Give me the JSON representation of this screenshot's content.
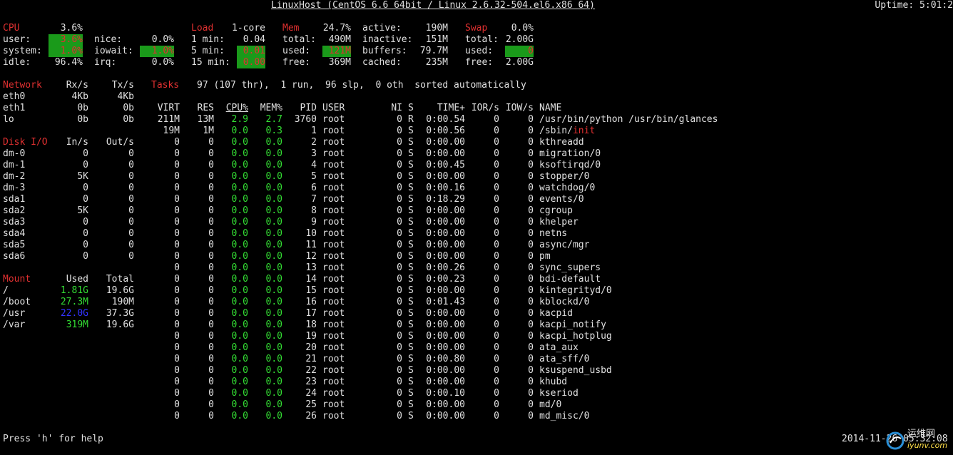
{
  "header": {
    "title": "LinuxHost (CentOS 6.6 64bit / Linux 2.6.32-504.el6.x86 64)",
    "uptime": "Uptime: 5:01:2"
  },
  "cpu": {
    "title": "CPU",
    "total": "3.6%",
    "user_label": "user:",
    "user": "3.6%",
    "system_label": "system:",
    "system": "1.0%",
    "idle_label": "idle:",
    "idle": "96.4%",
    "nice_label": "nice:",
    "nice": "0.0%",
    "iowait_label": "iowait:",
    "iowait": "1.0%",
    "irq_label": "irq:",
    "irq": "0.0%"
  },
  "load": {
    "title": "Load",
    "cores": "1-core",
    "min1_label": "1 min:",
    "min1": "0.04",
    "min5_label": "5 min:",
    "min5": "0.01",
    "min15_label": "15 min:",
    "min15": "0.00"
  },
  "mem": {
    "title": "Mem",
    "percent": "24.7%",
    "total_label": "total:",
    "total": "490M",
    "used_label": "used:",
    "used": "121M",
    "free_label": "free:",
    "free": "369M",
    "active_label": "active:",
    "active": "190M",
    "inactive_label": "inactive:",
    "inactive": "151M",
    "buffers_label": "buffers:",
    "buffers": "79.7M",
    "cached_label": "cached:",
    "cached": "235M"
  },
  "swap": {
    "title": "Swap",
    "percent": "0.0%",
    "total_label": "total:",
    "total": "2.00G",
    "used_label": "used:",
    "used": "0",
    "free_label": "free:",
    "free": "2.00G"
  },
  "network": {
    "title": "Network",
    "rx_header": "Rx/s",
    "tx_header": "Tx/s",
    "rows": [
      {
        "name": "eth0",
        "rx": "4Kb",
        "tx": "4Kb"
      },
      {
        "name": "eth1",
        "rx": "0b",
        "tx": "0b"
      },
      {
        "name": "lo",
        "rx": "0b",
        "tx": "0b"
      }
    ]
  },
  "disk": {
    "title": "Disk I/O",
    "in_header": "In/s",
    "out_header": "Out/s",
    "rows": [
      {
        "name": "dm-0",
        "in": "0",
        "out": "0"
      },
      {
        "name": "dm-1",
        "in": "0",
        "out": "0"
      },
      {
        "name": "dm-2",
        "in": "5K",
        "out": "0"
      },
      {
        "name": "dm-3",
        "in": "0",
        "out": "0"
      },
      {
        "name": "sda1",
        "in": "0",
        "out": "0"
      },
      {
        "name": "sda2",
        "in": "5K",
        "out": "0"
      },
      {
        "name": "sda3",
        "in": "0",
        "out": "0"
      },
      {
        "name": "sda4",
        "in": "0",
        "out": "0"
      },
      {
        "name": "sda5",
        "in": "0",
        "out": "0"
      },
      {
        "name": "sda6",
        "in": "0",
        "out": "0"
      }
    ]
  },
  "mount": {
    "title": "Mount",
    "used_header": "Used",
    "total_header": "Total",
    "rows": [
      {
        "name": "/",
        "used": "1.81G",
        "total": "19.6G",
        "color": "green"
      },
      {
        "name": "/boot",
        "used": "27.3M",
        "total": "190M",
        "color": "green"
      },
      {
        "name": "/usr",
        "used": "22.0G",
        "total": "37.3G",
        "color": "blue"
      },
      {
        "name": "/var",
        "used": "319M",
        "total": "19.6G",
        "color": "green"
      }
    ]
  },
  "tasks": {
    "title": "Tasks",
    "summary": "97 (107 thr),  1 run,  96 slp,  0 oth  sorted automatically"
  },
  "process_table": {
    "headers": {
      "virt": "VIRT",
      "res": "RES",
      "cpu": "CPU%",
      "mem": "MEM%",
      "pid": "PID",
      "user": "USER",
      "ni": "NI",
      "s": "S",
      "time": "TIME+",
      "ior": "IOR/s",
      "iow": "IOW/s",
      "name": "NAME"
    },
    "rows": [
      {
        "virt": "211M",
        "res": "13M",
        "cpu": "2.9",
        "mem": "2.7",
        "pid": "3760",
        "user": "root",
        "ni": "0",
        "s": "R",
        "time": "0:00.54",
        "ior": "0",
        "iow": "0",
        "name": "/usr/bin/python /usr/bin/glances",
        "name2": ""
      },
      {
        "virt": "19M",
        "res": "1M",
        "cpu": "0.0",
        "mem": "0.3",
        "pid": "1",
        "user": "root",
        "ni": "0",
        "s": "S",
        "time": "0:00.56",
        "ior": "0",
        "iow": "0",
        "name": "/sbin/",
        "name2": "init"
      },
      {
        "virt": "0",
        "res": "0",
        "cpu": "0.0",
        "mem": "0.0",
        "pid": "2",
        "user": "root",
        "ni": "0",
        "s": "S",
        "time": "0:00.00",
        "ior": "0",
        "iow": "0",
        "name": "kthreadd",
        "name2": ""
      },
      {
        "virt": "0",
        "res": "0",
        "cpu": "0.0",
        "mem": "0.0",
        "pid": "3",
        "user": "root",
        "ni": "0",
        "s": "S",
        "time": "0:00.00",
        "ior": "0",
        "iow": "0",
        "name": "migration/0",
        "name2": ""
      },
      {
        "virt": "0",
        "res": "0",
        "cpu": "0.0",
        "mem": "0.0",
        "pid": "4",
        "user": "root",
        "ni": "0",
        "s": "S",
        "time": "0:00.45",
        "ior": "0",
        "iow": "0",
        "name": "ksoftirqd/0",
        "name2": ""
      },
      {
        "virt": "0",
        "res": "0",
        "cpu": "0.0",
        "mem": "0.0",
        "pid": "5",
        "user": "root",
        "ni": "0",
        "s": "S",
        "time": "0:00.00",
        "ior": "0",
        "iow": "0",
        "name": "stopper/0",
        "name2": ""
      },
      {
        "virt": "0",
        "res": "0",
        "cpu": "0.0",
        "mem": "0.0",
        "pid": "6",
        "user": "root",
        "ni": "0",
        "s": "S",
        "time": "0:00.16",
        "ior": "0",
        "iow": "0",
        "name": "watchdog/0",
        "name2": ""
      },
      {
        "virt": "0",
        "res": "0",
        "cpu": "0.0",
        "mem": "0.0",
        "pid": "7",
        "user": "root",
        "ni": "0",
        "s": "S",
        "time": "0:18.29",
        "ior": "0",
        "iow": "0",
        "name": "events/0",
        "name2": ""
      },
      {
        "virt": "0",
        "res": "0",
        "cpu": "0.0",
        "mem": "0.0",
        "pid": "8",
        "user": "root",
        "ni": "0",
        "s": "S",
        "time": "0:00.00",
        "ior": "0",
        "iow": "0",
        "name": "cgroup",
        "name2": ""
      },
      {
        "virt": "0",
        "res": "0",
        "cpu": "0.0",
        "mem": "0.0",
        "pid": "9",
        "user": "root",
        "ni": "0",
        "s": "S",
        "time": "0:00.00",
        "ior": "0",
        "iow": "0",
        "name": "khelper",
        "name2": ""
      },
      {
        "virt": "0",
        "res": "0",
        "cpu": "0.0",
        "mem": "0.0",
        "pid": "10",
        "user": "root",
        "ni": "0",
        "s": "S",
        "time": "0:00.00",
        "ior": "0",
        "iow": "0",
        "name": "netns",
        "name2": ""
      },
      {
        "virt": "0",
        "res": "0",
        "cpu": "0.0",
        "mem": "0.0",
        "pid": "11",
        "user": "root",
        "ni": "0",
        "s": "S",
        "time": "0:00.00",
        "ior": "0",
        "iow": "0",
        "name": "async/mgr",
        "name2": ""
      },
      {
        "virt": "0",
        "res": "0",
        "cpu": "0.0",
        "mem": "0.0",
        "pid": "12",
        "user": "root",
        "ni": "0",
        "s": "S",
        "time": "0:00.00",
        "ior": "0",
        "iow": "0",
        "name": "pm",
        "name2": ""
      },
      {
        "virt": "0",
        "res": "0",
        "cpu": "0.0",
        "mem": "0.0",
        "pid": "13",
        "user": "root",
        "ni": "0",
        "s": "S",
        "time": "0:00.26",
        "ior": "0",
        "iow": "0",
        "name": "sync_supers",
        "name2": ""
      },
      {
        "virt": "0",
        "res": "0",
        "cpu": "0.0",
        "mem": "0.0",
        "pid": "14",
        "user": "root",
        "ni": "0",
        "s": "S",
        "time": "0:00.23",
        "ior": "0",
        "iow": "0",
        "name": "bdi-default",
        "name2": ""
      },
      {
        "virt": "0",
        "res": "0",
        "cpu": "0.0",
        "mem": "0.0",
        "pid": "15",
        "user": "root",
        "ni": "0",
        "s": "S",
        "time": "0:00.00",
        "ior": "0",
        "iow": "0",
        "name": "kintegrityd/0",
        "name2": ""
      },
      {
        "virt": "0",
        "res": "0",
        "cpu": "0.0",
        "mem": "0.0",
        "pid": "16",
        "user": "root",
        "ni": "0",
        "s": "S",
        "time": "0:01.43",
        "ior": "0",
        "iow": "0",
        "name": "kblockd/0",
        "name2": ""
      },
      {
        "virt": "0",
        "res": "0",
        "cpu": "0.0",
        "mem": "0.0",
        "pid": "17",
        "user": "root",
        "ni": "0",
        "s": "S",
        "time": "0:00.00",
        "ior": "0",
        "iow": "0",
        "name": "kacpid",
        "name2": ""
      },
      {
        "virt": "0",
        "res": "0",
        "cpu": "0.0",
        "mem": "0.0",
        "pid": "18",
        "user": "root",
        "ni": "0",
        "s": "S",
        "time": "0:00.00",
        "ior": "0",
        "iow": "0",
        "name": "kacpi_notify",
        "name2": ""
      },
      {
        "virt": "0",
        "res": "0",
        "cpu": "0.0",
        "mem": "0.0",
        "pid": "19",
        "user": "root",
        "ni": "0",
        "s": "S",
        "time": "0:00.00",
        "ior": "0",
        "iow": "0",
        "name": "kacpi_hotplug",
        "name2": ""
      },
      {
        "virt": "0",
        "res": "0",
        "cpu": "0.0",
        "mem": "0.0",
        "pid": "20",
        "user": "root",
        "ni": "0",
        "s": "S",
        "time": "0:00.00",
        "ior": "0",
        "iow": "0",
        "name": "ata_aux",
        "name2": ""
      },
      {
        "virt": "0",
        "res": "0",
        "cpu": "0.0",
        "mem": "0.0",
        "pid": "21",
        "user": "root",
        "ni": "0",
        "s": "S",
        "time": "0:00.80",
        "ior": "0",
        "iow": "0",
        "name": "ata_sff/0",
        "name2": ""
      },
      {
        "virt": "0",
        "res": "0",
        "cpu": "0.0",
        "mem": "0.0",
        "pid": "22",
        "user": "root",
        "ni": "0",
        "s": "S",
        "time": "0:00.00",
        "ior": "0",
        "iow": "0",
        "name": "ksuspend_usbd",
        "name2": ""
      },
      {
        "virt": "0",
        "res": "0",
        "cpu": "0.0",
        "mem": "0.0",
        "pid": "23",
        "user": "root",
        "ni": "0",
        "s": "S",
        "time": "0:00.00",
        "ior": "0",
        "iow": "0",
        "name": "khubd",
        "name2": ""
      },
      {
        "virt": "0",
        "res": "0",
        "cpu": "0.0",
        "mem": "0.0",
        "pid": "24",
        "user": "root",
        "ni": "0",
        "s": "S",
        "time": "0:00.10",
        "ior": "0",
        "iow": "0",
        "name": "kseriod",
        "name2": ""
      },
      {
        "virt": "0",
        "res": "0",
        "cpu": "0.0",
        "mem": "0.0",
        "pid": "25",
        "user": "root",
        "ni": "0",
        "s": "S",
        "time": "0:00.00",
        "ior": "0",
        "iow": "0",
        "name": "md/0",
        "name2": ""
      },
      {
        "virt": "0",
        "res": "0",
        "cpu": "0.0",
        "mem": "0.0",
        "pid": "26",
        "user": "root",
        "ni": "0",
        "s": "S",
        "time": "0:00.00",
        "ior": "0",
        "iow": "0",
        "name": "md_misc/0",
        "name2": ""
      }
    ]
  },
  "footer": {
    "help": "Press 'h' for help",
    "datetime": "2014-11-26 05:32:08",
    "watermark_text": "运维网",
    "watermark_sub": "iyunv.com"
  },
  "colors": {
    "background": "#000000",
    "text": "#e0e0e0",
    "title_red": "#e03030",
    "ok_green": "#33dd33",
    "bar_green": "#1a9a1a",
    "usage_blue": "#3333ff"
  }
}
